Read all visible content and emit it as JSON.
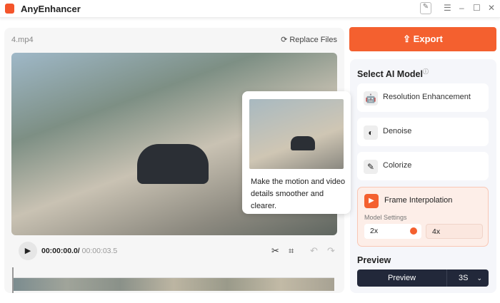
{
  "app": {
    "title": "AnyEnhancer"
  },
  "left": {
    "file_name": "4.mp4",
    "replace_label": "Replace Files",
    "tooltip": "Make the motion and video details smoother and clearer.",
    "current_time": "00:00:00.0/",
    "total_time": " 00:00:03.5"
  },
  "export_label": "Export",
  "panel": {
    "title": "Select AI Model",
    "models": [
      "Resolution Enhancement",
      "Denoise",
      "Colorize",
      "Frame Interpolation"
    ],
    "settings_label": "Model Settings",
    "options": [
      "2x",
      "4x"
    ],
    "preview_title": "Preview",
    "preview_button": "Preview",
    "preview_duration": "3S"
  },
  "colors": {
    "accent": "#f4602f",
    "dark": "#22283a"
  }
}
